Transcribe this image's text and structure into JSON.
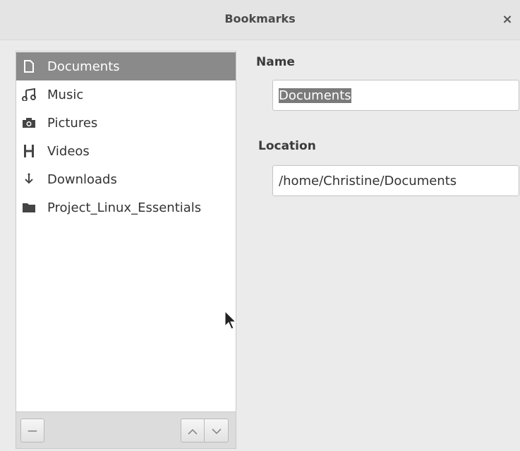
{
  "window": {
    "title": "Bookmarks",
    "close_label": "×"
  },
  "sidebar": {
    "items": [
      {
        "label": "Documents",
        "icon": "document-icon",
        "selected": true
      },
      {
        "label": "Music",
        "icon": "music-icon",
        "selected": false
      },
      {
        "label": "Pictures",
        "icon": "camera-icon",
        "selected": false
      },
      {
        "label": "Videos",
        "icon": "film-icon",
        "selected": false
      },
      {
        "label": "Downloads",
        "icon": "download-icon",
        "selected": false
      },
      {
        "label": "Project_Linux_Essentials",
        "icon": "folder-icon",
        "selected": false
      }
    ]
  },
  "toolbar": {
    "remove_label": "−",
    "up_label": "^",
    "down_label": "v"
  },
  "form": {
    "name_label": "Name",
    "name_value": "Documents",
    "location_label": "Location",
    "location_value": "/home/Christine/Documents"
  },
  "colors": {
    "selection": "#8a8a8a",
    "window_bg": "#ebebeb"
  }
}
